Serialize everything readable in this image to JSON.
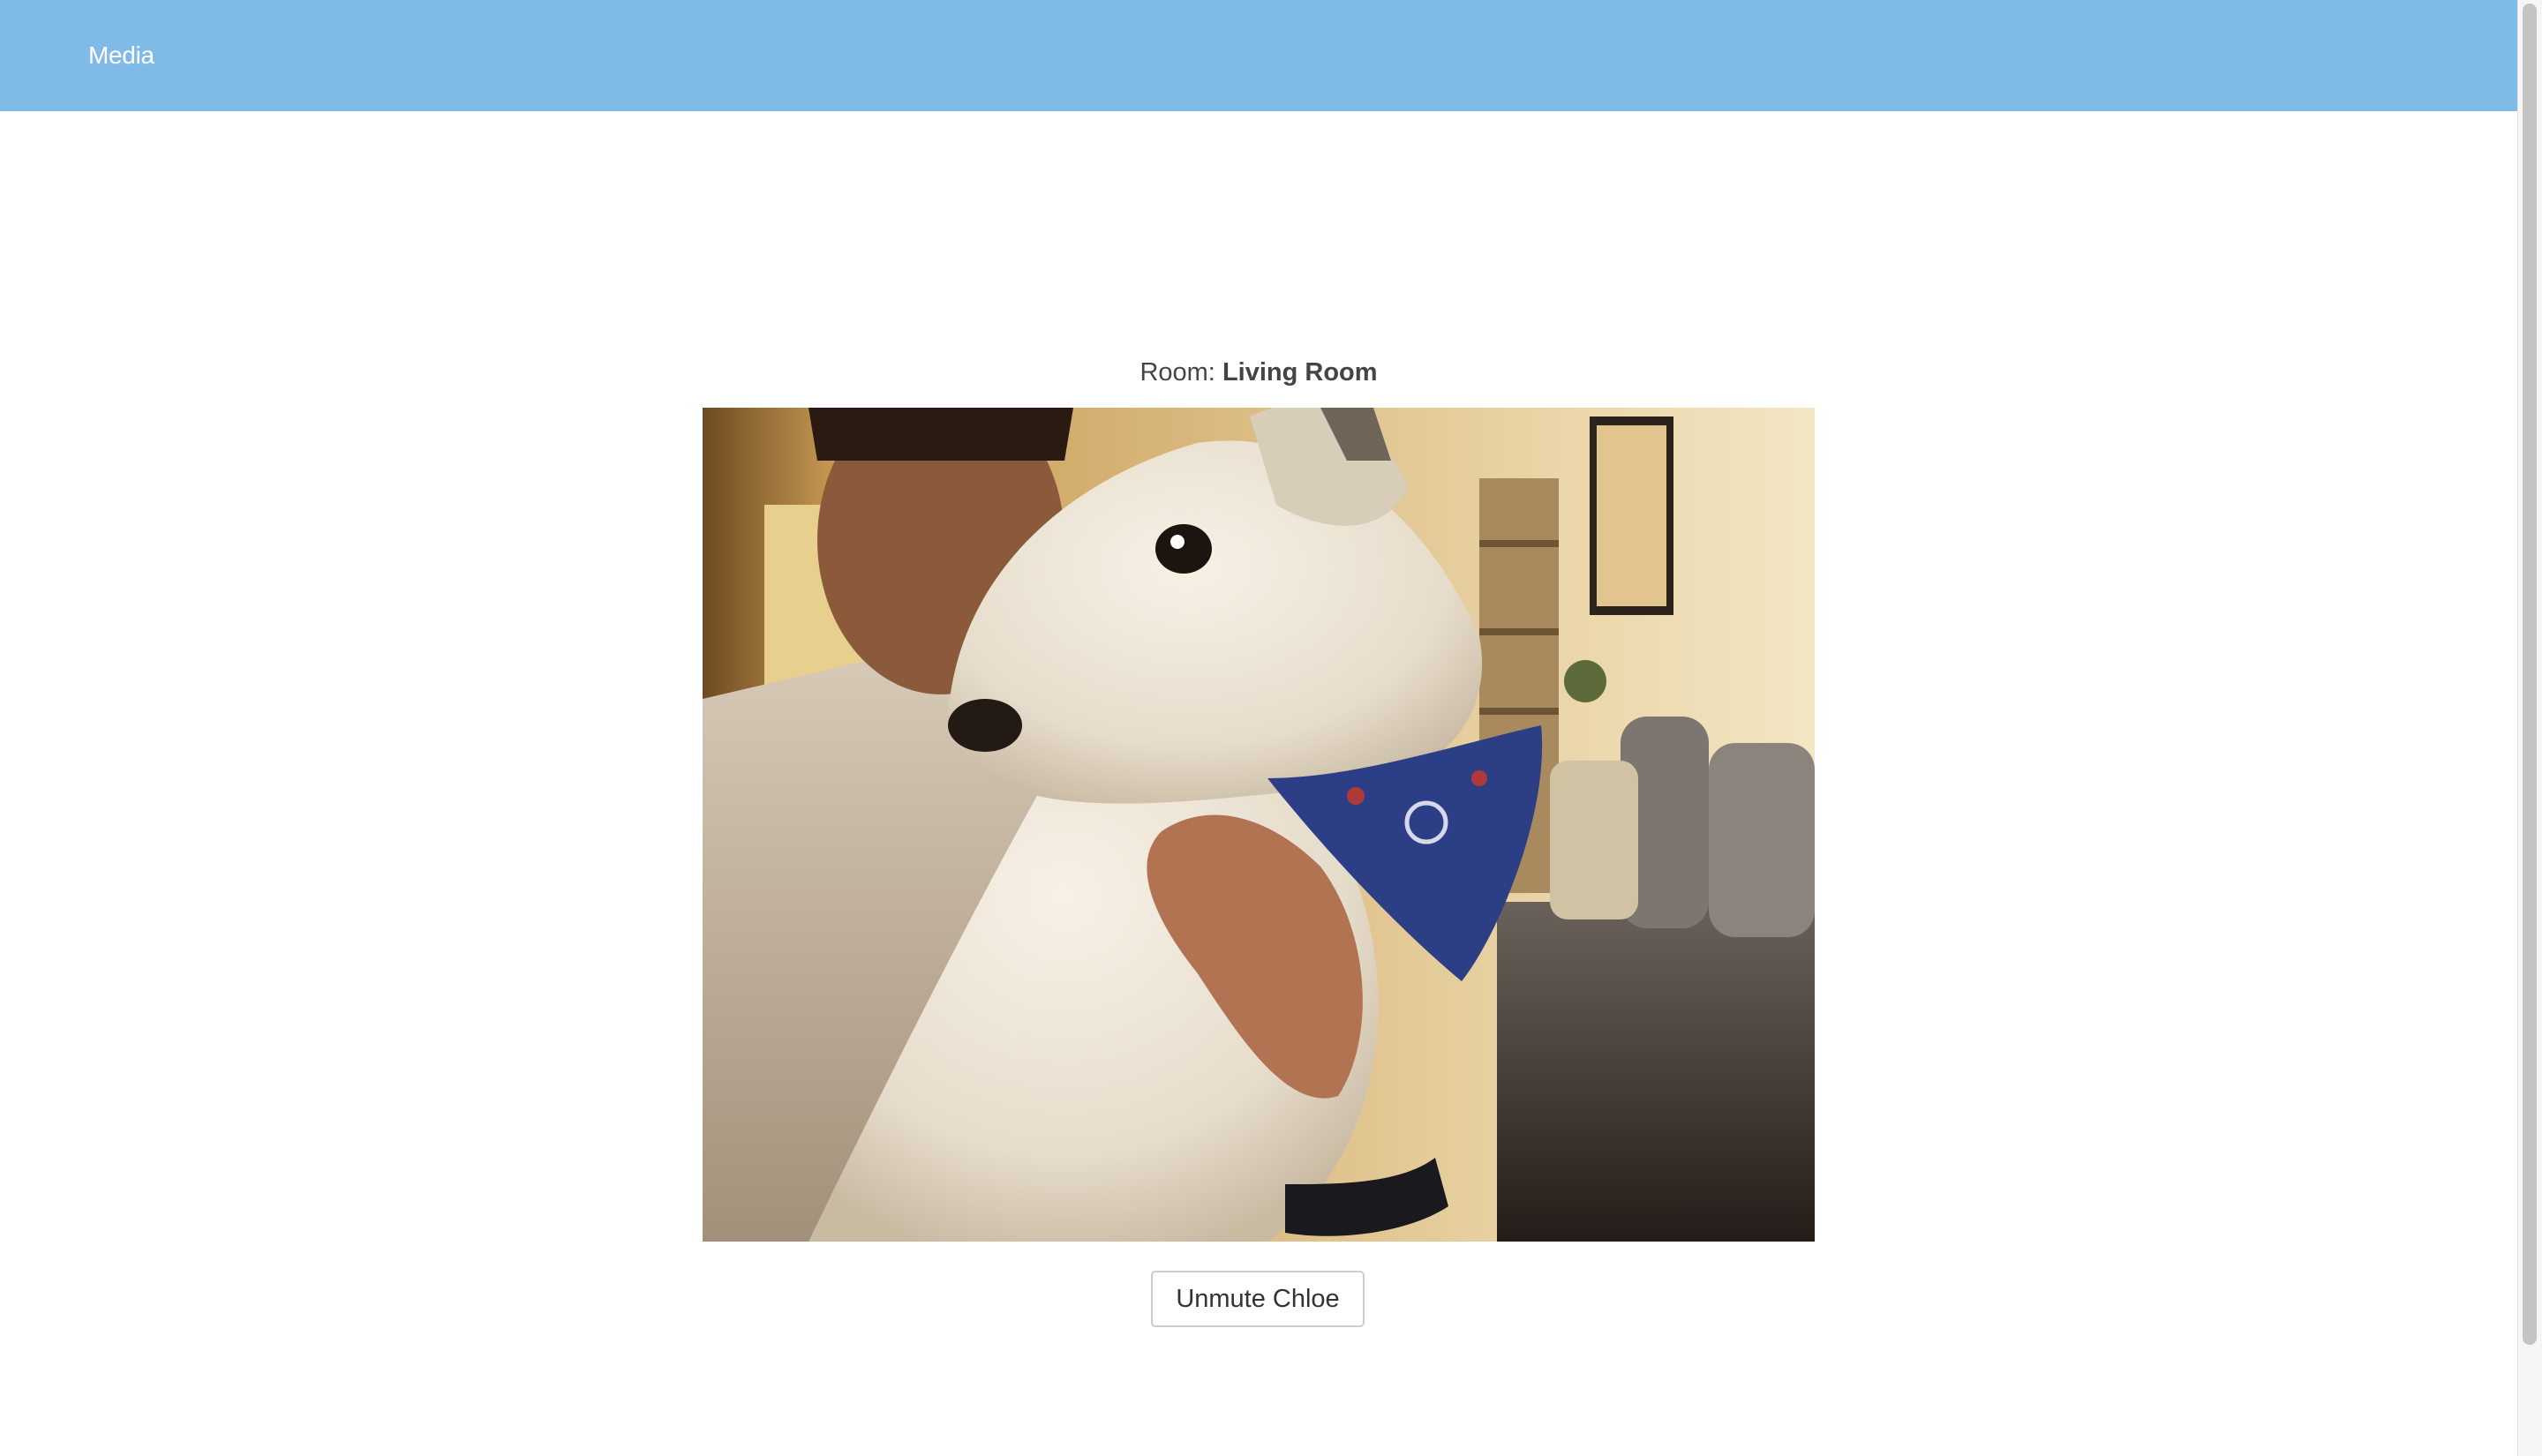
{
  "navbar": {
    "brand": "Media",
    "background_color": "#7fbbe6"
  },
  "room": {
    "prefix": "Room: ",
    "name": "Living Room"
  },
  "video": {
    "icon": "camera-feed"
  },
  "controls": {
    "unmute_label": "Unmute Chloe"
  }
}
